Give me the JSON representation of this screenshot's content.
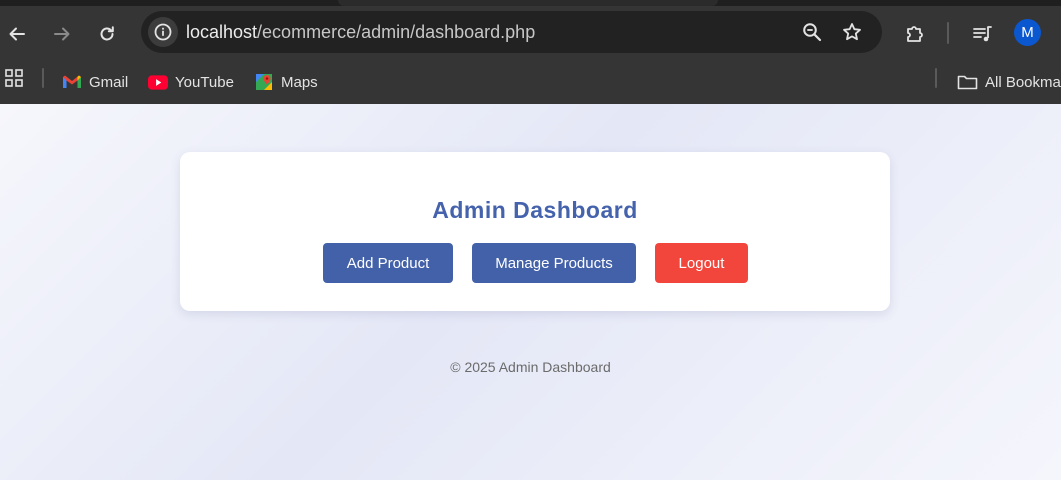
{
  "browser": {
    "url": {
      "host": "localhost",
      "path": "/ecommerce/admin/dashboard.php"
    },
    "profile_initial": "M",
    "bookmarks": [
      {
        "label": "Gmail",
        "icon": "gmail-icon"
      },
      {
        "label": "YouTube",
        "icon": "youtube-icon"
      },
      {
        "label": "Maps",
        "icon": "maps-icon"
      }
    ],
    "all_bookmarks_label": "All Bookma"
  },
  "page": {
    "title": "Admin Dashboard",
    "buttons": {
      "add_product": "Add Product",
      "manage_products": "Manage Products",
      "logout": "Logout"
    },
    "footer": "© 2025 Admin Dashboard"
  },
  "colors": {
    "title": "#4563ad",
    "primary_button": "#4361a8",
    "logout_button": "#f2453b"
  }
}
